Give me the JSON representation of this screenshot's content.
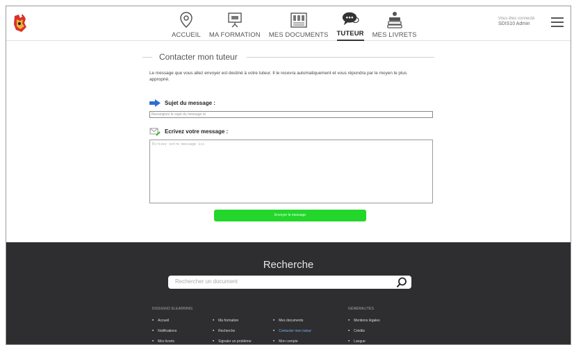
{
  "header": {
    "nav": [
      {
        "label": "ACCUEIL",
        "icon": "map-pin-icon"
      },
      {
        "label": "MA FORMATION",
        "icon": "presentation-board-icon"
      },
      {
        "label": "MES DOCUMENTS",
        "icon": "documents-grid-icon"
      },
      {
        "label": "TUTEUR",
        "icon": "chat-bubbles-icon"
      },
      {
        "label": "MES LIVRETS",
        "icon": "booklet-stack-icon"
      }
    ],
    "user_caption": "Vous êtes connecté",
    "user_name": "SDIS10 Admin"
  },
  "main": {
    "section_title": "Contacter mon tuteur",
    "intro": "Le message que vous allez envoyer est destiné à votre tuteur. Il le recevra automatiquement et vous répondra par le moyen le plus approprié.",
    "subject_label": "Sujet du message :",
    "subject_placeholder": "Renseignez le sujet du message ici",
    "message_label": "Ecrivez votre message :",
    "message_placeholder": "Ecrivez votre message ici",
    "send_label": "Envoyer le message"
  },
  "footer": {
    "title": "Recherche",
    "search_placeholder": "Rechercher un document",
    "col1_head": "DISSIGNO ELEARNING",
    "col4_head": "GÉNÉRALITÉS",
    "links": {
      "accueil": "Accueil",
      "notifications": "Notifications",
      "mes_livrets": "Mes livrets",
      "ma_formation": "Ma formation",
      "recherche": "Recherche",
      "signaler": "Signaler un problème",
      "mes_documents": "Mes documents",
      "contacter": "Contacter mon tuteur",
      "mon_compte": "Mon compte",
      "mentions": "Mentions légales",
      "credits": "Crédits",
      "langue": "Langue"
    }
  },
  "colors": {
    "accent_green": "#22d72a",
    "footer_bg": "#2e2e30",
    "link_highlight": "#7fa9e8"
  }
}
